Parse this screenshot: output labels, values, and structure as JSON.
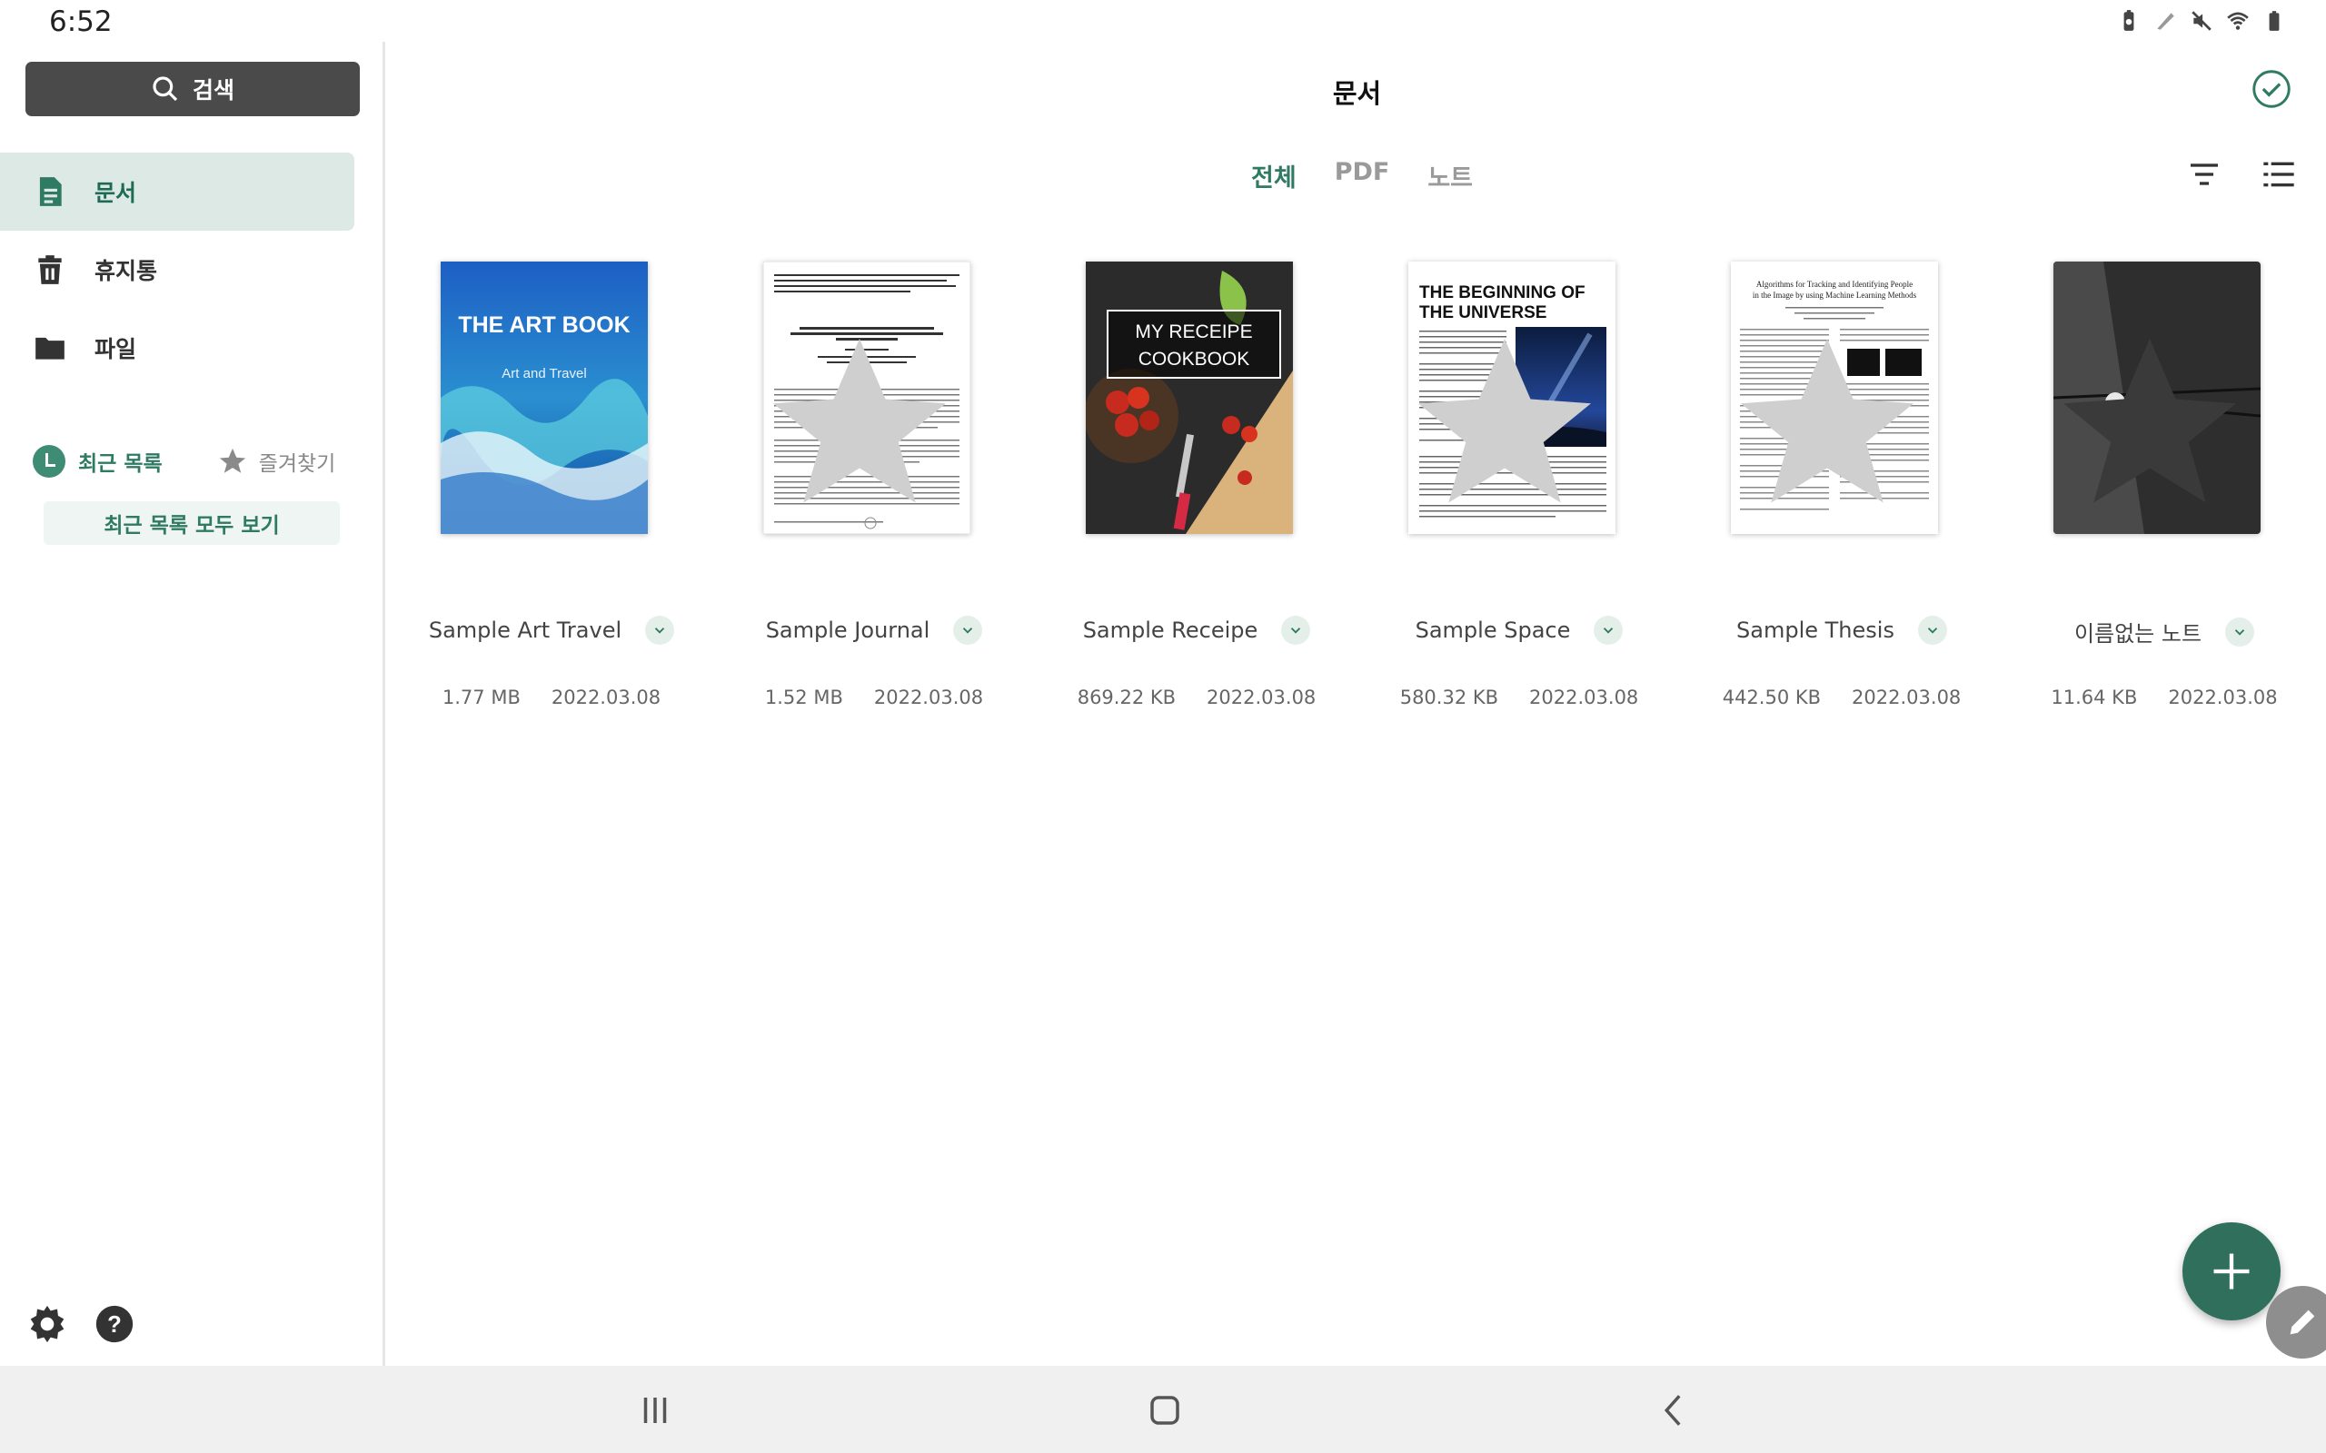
{
  "status": {
    "time": "6:52"
  },
  "sidebar": {
    "search_label": "검색",
    "items": [
      {
        "label": "문서",
        "icon": "document-icon",
        "active": true
      },
      {
        "label": "휴지통",
        "icon": "trash-icon"
      },
      {
        "label": "파일",
        "icon": "folder-icon"
      }
    ],
    "recent_label": "최근 목록",
    "favorites_label": "즐겨찾기",
    "view_all_label": "최근 목록 모두 보기"
  },
  "main": {
    "title": "문서",
    "tabs": [
      {
        "label": "전체",
        "active": true
      },
      {
        "label": "PDF"
      },
      {
        "label": "노트"
      }
    ]
  },
  "documents": [
    {
      "name": "Sample Art Travel",
      "size": "1.77 MB",
      "date": "2022.03.08",
      "cover_title": "THE ART BOOK",
      "cover_subtitle": "Art and Travel"
    },
    {
      "name": "Sample Journal",
      "size": "1.52 MB",
      "date": "2022.03.08",
      "cover_title": "STRATEGIC MANAGEMENT OF TENURE SECURITY: A CASE STUDY OF 'JJOGBANGS' IN KOREA"
    },
    {
      "name": "Sample Receipe",
      "size": "869.22 KB",
      "date": "2022.03.08",
      "cover_title": "MY RECEIPE",
      "cover_subtitle": "COOKBOOK"
    },
    {
      "name": "Sample Space",
      "size": "580.32 KB",
      "date": "2022.03.08",
      "cover_title": "THE BEGINNING OF",
      "cover_subtitle": "THE UNIVERSE"
    },
    {
      "name": "Sample Thesis",
      "size": "442.50 KB",
      "date": "2022.03.08",
      "cover_title": "Algorithms for Tracking and Identifying People",
      "cover_subtitle": "in the Image by using Machine Learning Methods"
    },
    {
      "name": "이름없는 노트",
      "size": "11.64 KB",
      "date": "2022.03.08"
    }
  ],
  "colors": {
    "accent": "#2f6f5c",
    "accent_light": "#dde9e4",
    "tab_active": "#2f7a63"
  }
}
